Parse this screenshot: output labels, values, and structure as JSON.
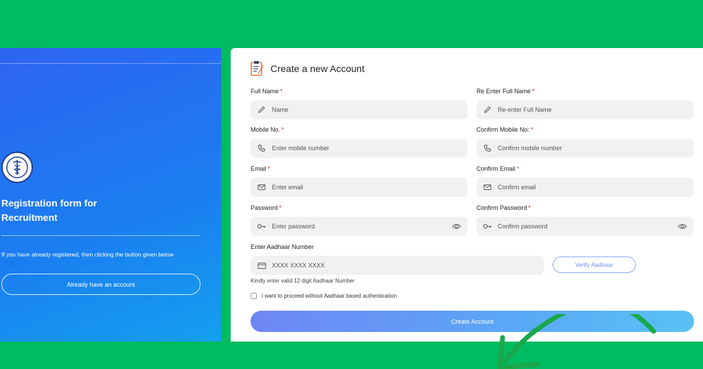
{
  "sidebar": {
    "title": "Registration form for Recruitment",
    "note": "If you have already registered, then clicking the button given below",
    "already_button": "Already have an account"
  },
  "form": {
    "title": "Create a new Account",
    "required_mark": "*",
    "fields": {
      "full_name": {
        "label": "Full Name",
        "placeholder": "Name"
      },
      "re_full_name": {
        "label": "Re Enter Full Name",
        "placeholder": "Re-enter Full Name"
      },
      "mobile": {
        "label": "Mobile No.",
        "placeholder": "Enter mobile number"
      },
      "confirm_mobile": {
        "label": "Confirm Mobile No:",
        "placeholder": "Confirm mobile number"
      },
      "email": {
        "label": "Email",
        "placeholder": "Enter email"
      },
      "confirm_email": {
        "label": "Confirm Email",
        "placeholder": "Confirm email"
      },
      "password": {
        "label": "Password",
        "placeholder": "Enter password"
      },
      "confirm_password": {
        "label": "Confirm Password",
        "placeholder": "Confirm password"
      },
      "aadhaar": {
        "label": "Enter Aadhaar Number",
        "placeholder": "XXXX XXXX XXXX"
      }
    },
    "verify_button": "Verify Aadhaar",
    "aadhaar_hint": "Kindly enter valid 12 digit Aadhaar Number",
    "checkbox_label": "I want to proceed without Aadhaar based authentication",
    "create_button": "Create Account"
  },
  "colors": {
    "frame_green": "#00bb5f",
    "panel_blue": "#2e63f2",
    "arrow_green": "#1aa84a",
    "required_red": "#e02020"
  }
}
